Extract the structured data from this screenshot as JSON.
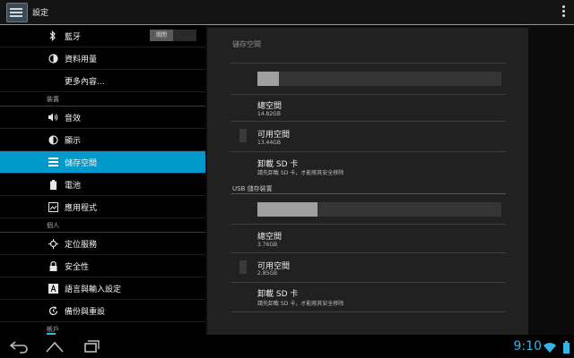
{
  "app": {
    "title": "設定"
  },
  "left": {
    "items": [
      {
        "icon": "bluetooth-icon",
        "label": "藍牙",
        "switch": "關閉"
      },
      {
        "icon": "data-usage-icon",
        "label": "資料用量"
      },
      {
        "icon": "",
        "label": "更多內容..."
      }
    ],
    "section_device": "裝置",
    "device_items": [
      {
        "icon": "sound-icon",
        "label": "音效"
      },
      {
        "icon": "display-icon",
        "label": "顯示"
      },
      {
        "icon": "storage-icon",
        "label": "儲存空間"
      },
      {
        "icon": "battery-icon",
        "label": "電池"
      },
      {
        "icon": "apps-icon",
        "label": "應用程式"
      }
    ],
    "section_personal": "個人",
    "personal_items": [
      {
        "icon": "location-icon",
        "label": "定位服務"
      },
      {
        "icon": "lock-icon",
        "label": "安全性"
      },
      {
        "icon": "language-icon",
        "label": "語言與輸入設定"
      },
      {
        "icon": "backup-icon",
        "label": "備份與重設"
      }
    ],
    "section_accounts": "帳戶"
  },
  "panel": {
    "title": "儲存空間",
    "internal": {
      "used_fraction": 0.09,
      "total_label": "總空間",
      "total_value": "14.82GB",
      "available_label": "可用空間",
      "available_value": "13.44GB",
      "unmount_label": "卸載 SD 卡",
      "unmount_sub": "請先卸載 SD 卡，才能將其安全移除"
    },
    "usb_section": "USB 儲存裝置",
    "usb": {
      "used_fraction": 0.245,
      "total_label": "總空間",
      "total_value": "3.76GB",
      "available_label": "可用空間",
      "available_value": "2.85GB",
      "unmount_label": "卸載 SD 卡",
      "unmount_sub": "請先卸載 SD 卡，才能將其安全移除"
    }
  },
  "status": {
    "time": "9:10"
  },
  "colors": {
    "accent": "#33b5e5",
    "selected": "#0099cc"
  }
}
